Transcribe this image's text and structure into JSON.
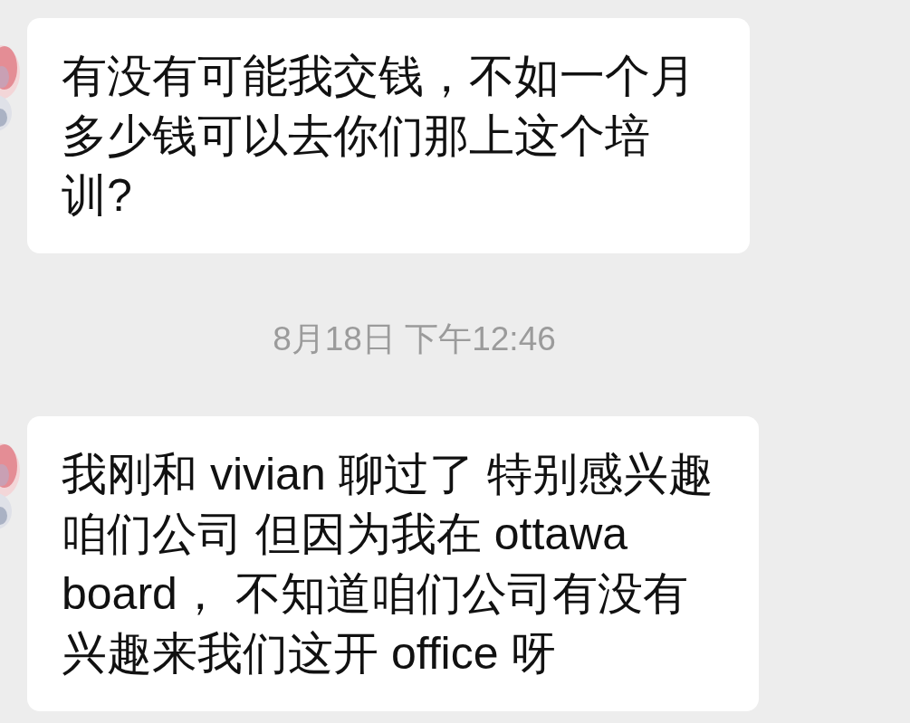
{
  "messages": [
    {
      "kind": "message",
      "text": "有没有可能我交钱，不如一个月多少钱可以去你们那上这个培训?"
    },
    {
      "kind": "timestamp",
      "text": "8月18日 下午12:46"
    },
    {
      "kind": "message",
      "text": "我刚和 vivian 聊过了 特别感兴趣咱们公司 但因为我在 ottawa board， 不知道咱们公司有没有兴趣来我们这开 office 呀"
    }
  ]
}
